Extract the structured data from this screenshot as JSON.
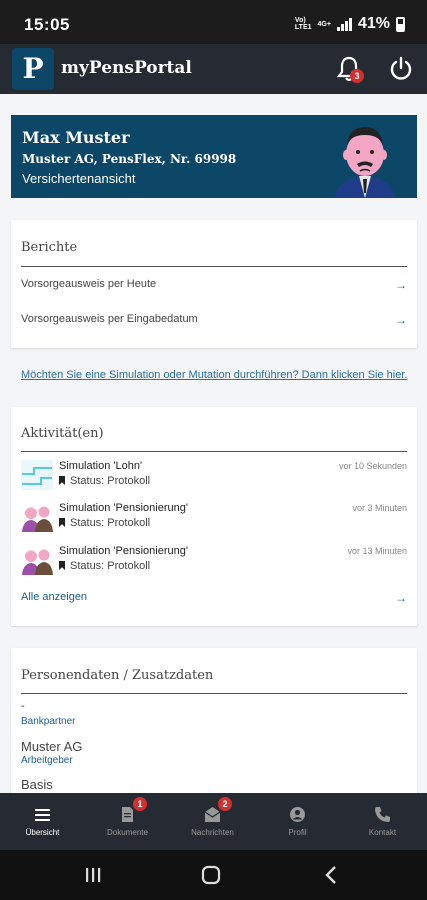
{
  "status_bar": {
    "time": "15:05",
    "signal_text": "Vo»)\nLTE1",
    "network": "4G+",
    "battery": "41%"
  },
  "app_bar": {
    "logo_letter": "P",
    "title": "myPensPortal",
    "notification_count": "3"
  },
  "user_card": {
    "name": "Max Muster",
    "subtitle": "Muster AG, PensFlex, Nr. 69998",
    "role": "Versichertenansicht"
  },
  "reports": {
    "title": "Berichte",
    "items": [
      {
        "label": "Vorsorgeausweis per Heute",
        "arrow": "→"
      },
      {
        "label": "Vorsorgeausweis per Eingabedatum",
        "arrow": "→"
      }
    ]
  },
  "simulation_link": "Möchten Sie eine Simulation oder Mutation durchführen? Dann klicken Sie hier.",
  "activities": {
    "title": "Aktivität(en)",
    "items": [
      {
        "title": "Simulation 'Lohn'",
        "status": "Status: Protokoll",
        "time": "vor 10 Sekunden",
        "icon": "chart-icon"
      },
      {
        "title": "Simulation 'Pensionierung'",
        "status": "Status: Protokoll",
        "time": "vor 3 Minuten",
        "icon": "elderly-couple-icon"
      },
      {
        "title": "Simulation 'Pensionierung'",
        "status": "Status: Protokoll",
        "time": "vor 13 Minuten",
        "icon": "elderly-couple-icon"
      }
    ],
    "show_all": "Alle anzeigen",
    "show_all_arrow": "→"
  },
  "personal_data": {
    "title": "Personendaten / Zusatzdaten",
    "dash": "-",
    "bank_label": "Bankpartner",
    "employer_value": "Muster AG",
    "employer_label": "Arbeitgeber",
    "plan_value": "Basis"
  },
  "bottom_nav": [
    {
      "label": "Übersicht",
      "icon": "menu-icon",
      "active": true,
      "badge": ""
    },
    {
      "label": "Dokumente",
      "icon": "document-icon",
      "active": false,
      "badge": "1"
    },
    {
      "label": "Nachrichten",
      "icon": "mail-icon",
      "active": false,
      "badge": "2"
    },
    {
      "label": "Profil",
      "icon": "user-icon",
      "active": false,
      "badge": ""
    },
    {
      "label": "Kontakt",
      "icon": "phone-icon",
      "active": false,
      "badge": ""
    }
  ],
  "colors": {
    "brand": "#0c4767",
    "appbar": "#262b33",
    "link": "#2a6f9e",
    "badge": "#d32f2f"
  }
}
